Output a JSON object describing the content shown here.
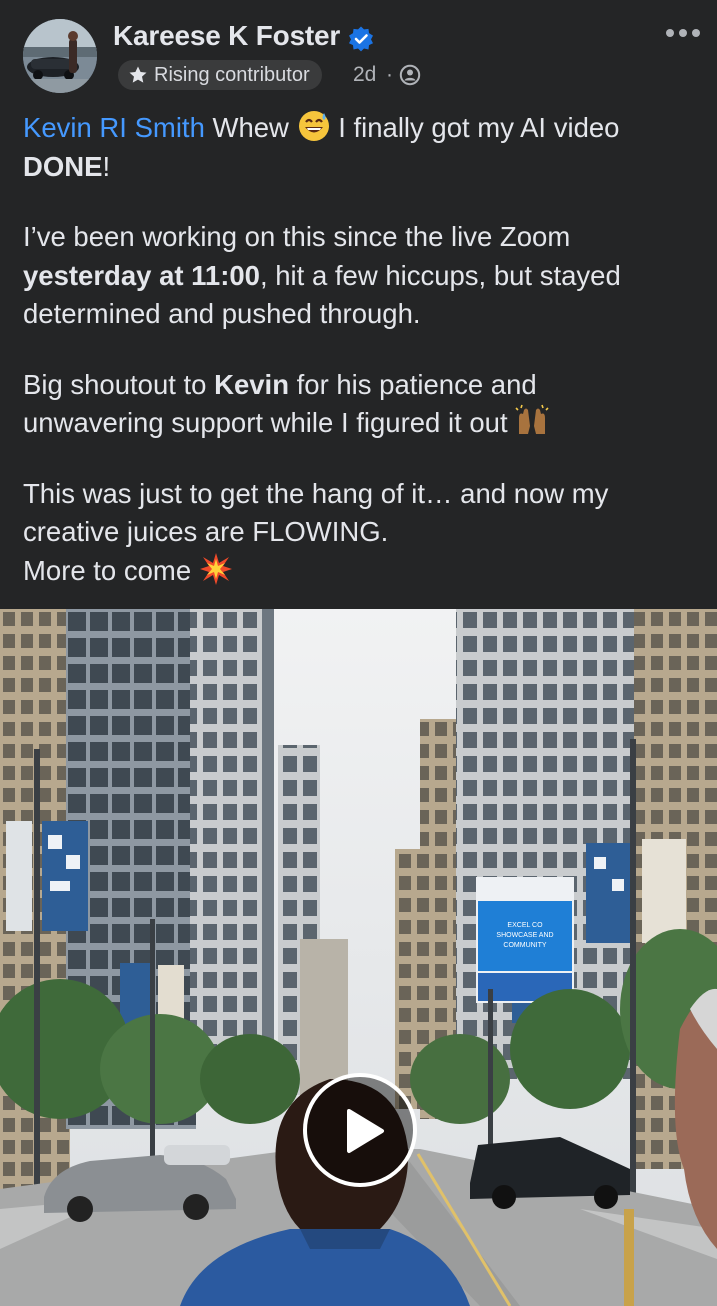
{
  "post": {
    "author": "Kareese K Foster",
    "badge": "Rising contributor",
    "time": "2d",
    "separator": "·",
    "body": {
      "l1": {
        "mention": "Kevin RI Smith",
        "pre": " Whew ",
        "post": " I finally got my AI video"
      },
      "l2": {
        "bold": "DONE",
        "rest": "!"
      },
      "l3": "I’ve been working on this since the live Zoom",
      "l4": {
        "bold": "yesterday at 11:00",
        "rest": ", hit a few hiccups, but stayed"
      },
      "l5": "determined and pushed through.",
      "l6": {
        "pre": "Big shoutout to ",
        "bold": "Kevin",
        "rest": " for his patience and"
      },
      "l7": "unwavering support while I figured it out ",
      "l8": "This was just to get the hang of it… and now my",
      "l9": "creative juices are FLOWING.",
      "l10": "More to come "
    },
    "emojis": [
      "grinning-sweat-emoji",
      "raising-hands-emoji",
      "collision-emoji"
    ]
  },
  "media": {
    "billboard_lines": [
      "EXCEL CO",
      "SHOWCASE AND",
      "COMMUNITY"
    ],
    "colors": {
      "sky": "#e9ebed",
      "billboard": "#1f7fd6",
      "jacket": "#2b5aa0"
    }
  },
  "colors": {
    "background": "#242526",
    "text": "#e4e6eb",
    "mention": "#4599ff",
    "verified": "#1b74e4",
    "muted": "#b0b3b8"
  }
}
